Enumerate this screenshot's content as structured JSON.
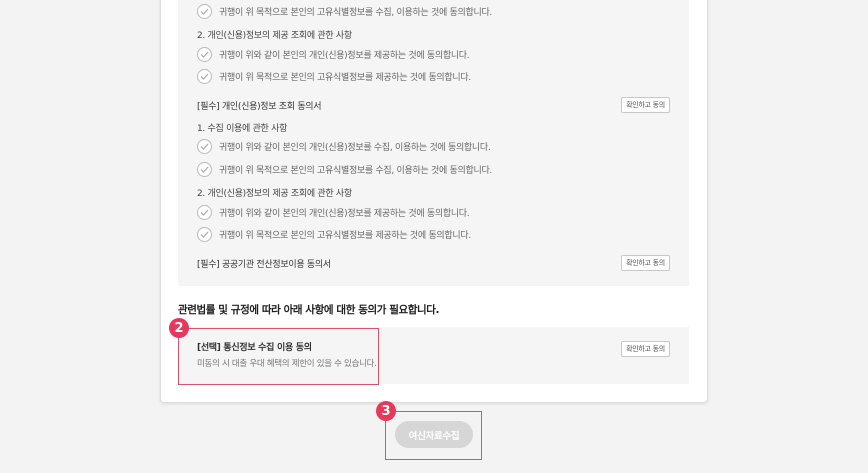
{
  "consent_sections": [
    {
      "items_top": [
        {
          "text": "귀행이 위 목적으로 본인의 고유식별정보를 수집, 이용하는 것에 동의합니다."
        }
      ],
      "sub2_title": "2. 개인(신용)정보의 제공 조회에 관한 사항",
      "sub2_items": [
        {
          "text": "귀행이 위와 같이 본인의 개인(신용)정보를 제공하는 것에 동의합니다."
        },
        {
          "text": "귀행이 위 목적으로 본인의 고유식별정보를 제공하는 것에 동의합니다."
        }
      ]
    },
    {
      "title": "[필수] 개인(신용)정보 조회 동의서",
      "button": "확인하고 동의",
      "sub1_title": "1. 수집 이용에 관한 사항",
      "sub1_items": [
        {
          "text": "귀행이 위와 같이 본인의 개인(신용)정보를 수집, 이용하는 것에 동의합니다."
        },
        {
          "text": "귀행이 위 목적으로 본인의 고유식별정보를 수집, 이용하는 것에 동의합니다."
        }
      ],
      "sub2_title": "2. 개인(신용)정보의 제공 조회에 관한 사항",
      "sub2_items": [
        {
          "text": "귀행이 위와 같이 본인의 개인(신용)정보를 제공하는 것에 동의합니다."
        },
        {
          "text": "귀행이 위 목적으로 본인의 고유식별정보를 제공하는 것에 동의합니다."
        }
      ]
    },
    {
      "title": "[필수] 공공기관 전산정보이용 동의서",
      "button": "확인하고 동의"
    }
  ],
  "notice": "관련법률 및 규정에 따라 아래 사항에 대한 동의가 필요합니다.",
  "optional": {
    "title": "[선택] 통신정보 수집 이용 동의",
    "description": "미동의 시 대출 우대 혜택의 제한이 있을 수 있습니다.",
    "button": "확인하고 동의"
  },
  "step_badges": {
    "optional": "2",
    "submit": "3"
  },
  "submit_button": "여신자료수집",
  "colors": {
    "highlight": "#d9536a",
    "badge": "#e6385a",
    "submit_disabled": "#d6d6d6"
  }
}
